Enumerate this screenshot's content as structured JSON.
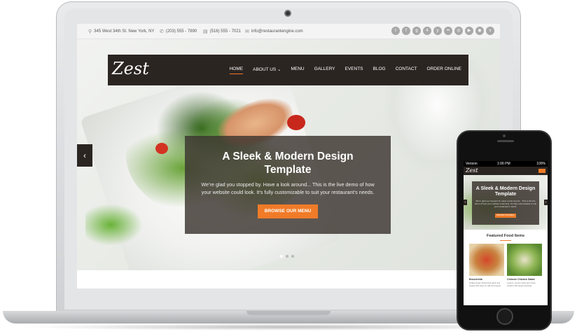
{
  "topbar": {
    "address": "345 West 34th St. New York, NY",
    "phone": "(203) 555 - 7890",
    "fax": "(516) 555 - 7021",
    "email": "info@restaurantengine.com",
    "social_icons": [
      "twitter-icon",
      "facebook-icon",
      "googleplus-icon",
      "foursquare-icon",
      "yelp-icon",
      "flickr-icon",
      "instagram-icon",
      "youtube-icon",
      "tripadvisor-icon",
      "vimeo-icon"
    ]
  },
  "site": {
    "logo": "Zest",
    "menu": [
      "HOME",
      "ABOUT US ⌄",
      "MENU",
      "GALLERY",
      "EVENTS",
      "BLOG",
      "CONTACT",
      "ORDER ONLINE"
    ],
    "active_menu": "HOME"
  },
  "hero": {
    "title": "A Sleek & Modern Design Template",
    "text": "We’re glad you stopped by.  Have a look around...  This is the live demo of how your website could look.  It’s fully customizable to suit your restaurant’s needs.",
    "button": "BROWSE OUR MENU",
    "prev_arrow": "‹",
    "slides": 3,
    "active_slide": 1
  },
  "phone": {
    "carrier": "Verizon",
    "time": "1:06 PM",
    "battery": "100%",
    "logo": "Zest",
    "hero_title": "A Sleek & Modern Design Template",
    "hero_text": "We’re glad you stopped by. Have a look around... This is the live demo of how your website could look. It’s fully customizable to suit your restaurant’s needs.",
    "hero_button": "BROWSE OUR MENU",
    "arrow_left": "‹",
    "arrow_right": "›",
    "featured_title": "Featured Food Items",
    "items": [
      {
        "name": "Bruschetta",
        "desc": "Grilled bread rubbed with garlic and topped with olive oil, salt and pepper."
      },
      {
        "name": "Chinese Chicken Salad",
        "desc": "Lettuce, wonton strips and crispy chicken with ginger dressing."
      }
    ]
  },
  "colors": {
    "accent": "#f07b28",
    "dark": "#2b2522"
  }
}
